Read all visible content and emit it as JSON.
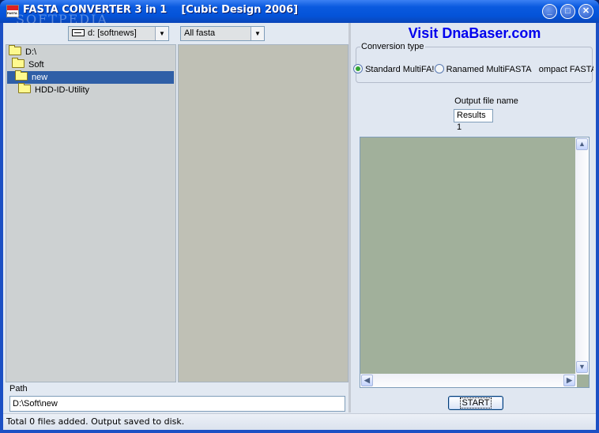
{
  "window": {
    "title": "FASTA CONVERTER 3 in 1    [Cubic Design 2006]",
    "minimize_glyph": "_",
    "maximize_glyph": "□",
    "close_glyph": "✕"
  },
  "watermark": "SOFTPEDIA",
  "left": {
    "drive_combo": {
      "value": "d: [softnews]"
    },
    "filter_combo": {
      "value": "All fasta"
    },
    "combo_arrow": "▼",
    "tree": [
      {
        "label": "D:\\",
        "icon": "open-folder-icon",
        "level": 0,
        "selected": false
      },
      {
        "label": "Soft",
        "icon": "open-folder-icon",
        "level": 1,
        "selected": false
      },
      {
        "label": "new",
        "icon": "open-folder-icon",
        "level": 1,
        "selected": true
      },
      {
        "label": "HDD-ID-Utility",
        "icon": "folder-icon",
        "level": 2,
        "selected": false
      }
    ],
    "path_label": "Path",
    "path_value": "D:\\Soft\\new"
  },
  "right": {
    "link": "Visit DnaBaser.com",
    "link_color": "#0000ee",
    "conversion_group_title": "Conversion type",
    "options": [
      {
        "label": "Standard MultiFA!",
        "checked": true
      },
      {
        "label": "Ranamed MultiFASTA",
        "checked": false
      },
      {
        "label": "ompact FASTA",
        "checked": false
      }
    ],
    "output_label": "Output file name",
    "output_value": "Results 1",
    "scroll": {
      "up": "▲",
      "down": "▼",
      "left": "◀",
      "right": "▶"
    },
    "start_label": "START"
  },
  "status": "Total 0 files added. Output saved to disk."
}
